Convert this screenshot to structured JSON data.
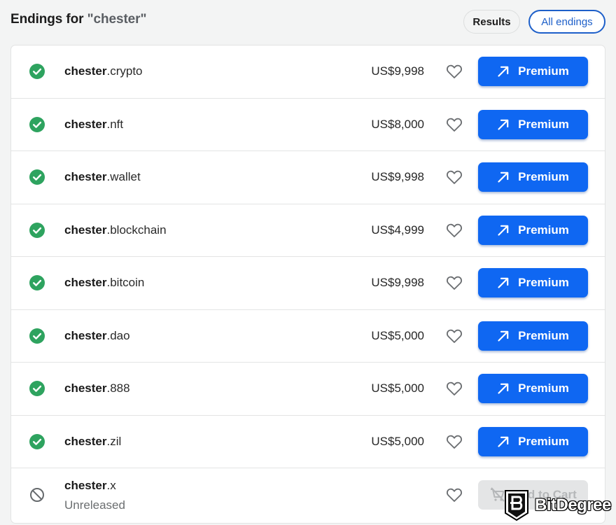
{
  "header": {
    "title_prefix": "Endings for ",
    "query": "\"chester\"",
    "filters": [
      {
        "label": "Results",
        "active": false
      },
      {
        "label": "All endings",
        "active": true
      }
    ]
  },
  "results": [
    {
      "base": "chester",
      "tld": ".crypto",
      "status": "available",
      "price": "US$9,998",
      "action": "Premium"
    },
    {
      "base": "chester",
      "tld": ".nft",
      "status": "available",
      "price": "US$8,000",
      "action": "Premium"
    },
    {
      "base": "chester",
      "tld": ".wallet",
      "status": "available",
      "price": "US$9,998",
      "action": "Premium"
    },
    {
      "base": "chester",
      "tld": ".blockchain",
      "status": "available",
      "price": "US$4,999",
      "action": "Premium"
    },
    {
      "base": "chester",
      "tld": ".bitcoin",
      "status": "available",
      "price": "US$9,998",
      "action": "Premium"
    },
    {
      "base": "chester",
      "tld": ".dao",
      "status": "available",
      "price": "US$5,000",
      "action": "Premium"
    },
    {
      "base": "chester",
      "tld": ".888",
      "status": "available",
      "price": "US$5,000",
      "action": "Premium"
    },
    {
      "base": "chester",
      "tld": ".zil",
      "status": "available",
      "price": "US$5,000",
      "action": "Premium"
    }
  ],
  "unavailable": {
    "base": "chester",
    "tld": ".x",
    "status_text": "Unreleased",
    "action": "Add to Cart"
  },
  "icons": {
    "available": "check-circle-icon",
    "unavailable": "prohibited-icon",
    "favorite": "heart-outline-icon",
    "premium": "arrow-up-right-icon",
    "cart": "cart-disabled-icon"
  },
  "colors": {
    "primary": "#0f67f2",
    "success": "#2ea35f",
    "outline_active": "#1d5fc9",
    "background": "#f3f4f4"
  },
  "watermark": {
    "text": "BitDegree"
  }
}
